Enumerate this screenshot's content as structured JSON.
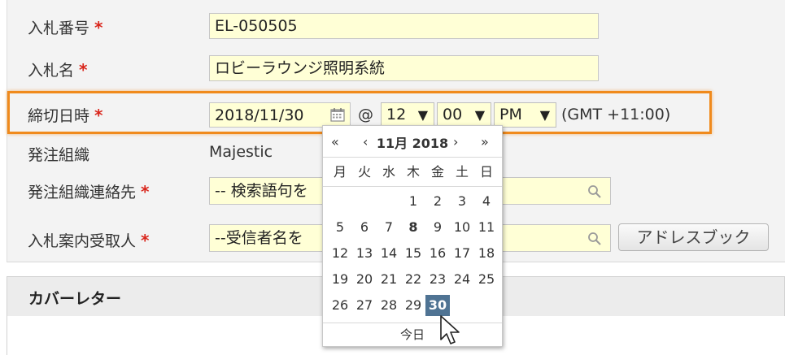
{
  "form": {
    "bid_number": {
      "label": "入札番号",
      "value": "EL-050505"
    },
    "bid_name": {
      "label": "入札名",
      "value": "ロビーラウンジ照明系統"
    },
    "deadline": {
      "label": "締切日時",
      "date": "2018/11/30",
      "at": "@",
      "hour": "12",
      "minute": "00",
      "ampm": "PM",
      "timezone": "(GMT +11:00)"
    },
    "ordering_org": {
      "label": "発注組織",
      "value": "Majestic"
    },
    "org_contact": {
      "label": "発注組織連絡先",
      "placeholder": "-- 検索語句を"
    },
    "invite_recipient": {
      "label": "入札案内受取人",
      "placeholder": "--受信者名を"
    },
    "required_mark": "*",
    "address_book_button": "アドレスブック"
  },
  "section": {
    "title": "カバーレター"
  },
  "calendar": {
    "prev_year": "«",
    "prev_month": "‹",
    "title": "11月 2018",
    "next_month": "›",
    "next_year": "»",
    "weekdays": [
      "月",
      "火",
      "水",
      "木",
      "金",
      "土",
      "日"
    ],
    "weeks": [
      [
        "",
        "",
        "",
        "1",
        "2",
        "3",
        "4"
      ],
      [
        "5",
        "6",
        "7",
        "8",
        "9",
        "10",
        "11"
      ],
      [
        "12",
        "13",
        "14",
        "15",
        "16",
        "17",
        "18"
      ],
      [
        "19",
        "20",
        "21",
        "22",
        "23",
        "24",
        "25"
      ],
      [
        "26",
        "27",
        "28",
        "29",
        "30",
        "",
        ""
      ]
    ],
    "today_day": "8",
    "selected_day": "30",
    "today_label": "今日",
    "selected_color": "#4f7393"
  },
  "colors": {
    "highlight_border": "#f08a1c",
    "required": "#d9261c",
    "field_background": "#ffffd6"
  },
  "icons": {
    "calendar": "calendar-icon",
    "lookup": "magnifier-icon",
    "dropdown": "dropdown-arrow-icon",
    "cursor": "mouse-pointer-icon"
  }
}
